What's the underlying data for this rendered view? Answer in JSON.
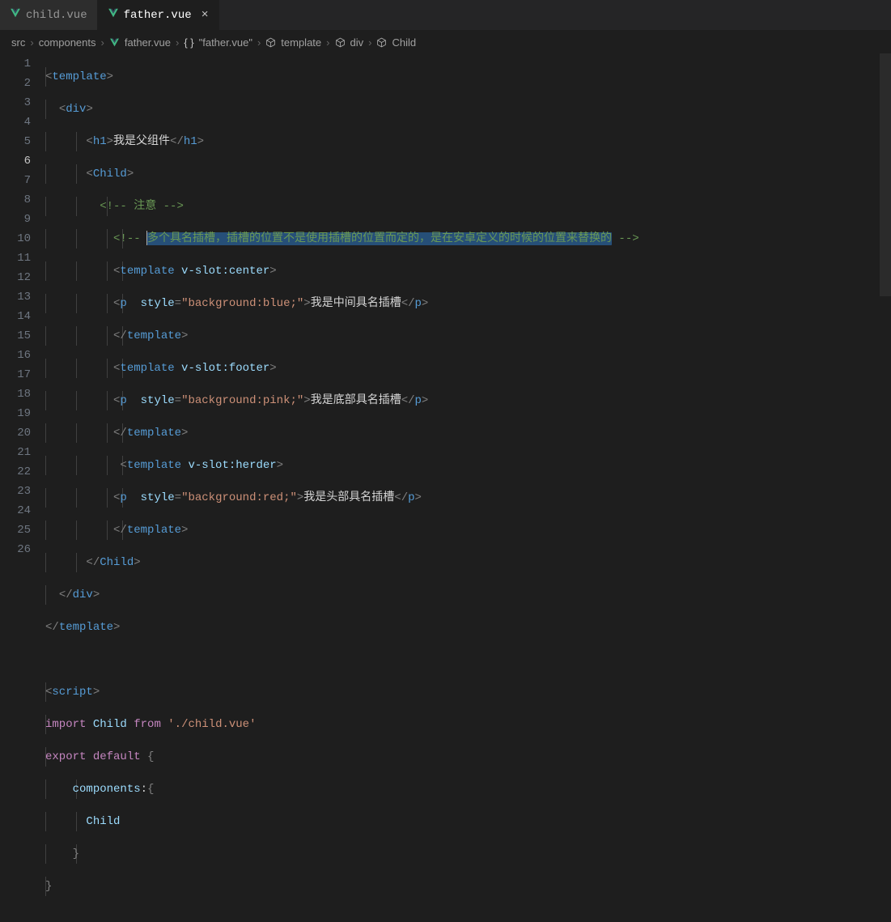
{
  "tabs": [
    {
      "label": "child.vue",
      "active": false
    },
    {
      "label": "father.vue",
      "active": true
    }
  ],
  "breadcrumbs": {
    "parts": [
      "src",
      "components",
      "father.vue",
      "\"father.vue\"",
      "template",
      "div",
      "Child"
    ]
  },
  "code": {
    "h1_text": "我是父组件",
    "comment_note": " 注意 ",
    "selected_comment": "多个具名插槽，插槽的位置不是使用插槽的位置而定的，是在安卓定义的时候的位置来替换的",
    "slot_center": "v-slot:center",
    "slot_footer": "v-slot:footer",
    "slot_herder": "v-slot:herder",
    "style_blue": "\"background:blue;\"",
    "style_pink": "\"background:pink;\"",
    "style_red": "\"background:red;\"",
    "p_center_text": "我是中间具名插槽",
    "p_footer_text": "我是底部具名插槽",
    "p_header_text": "我是头部具名插槽",
    "import_path": "'./child.vue'",
    "kw_import": "import",
    "kw_from": "from",
    "kw_export": "export",
    "kw_default": "default",
    "prop_components": "components",
    "ident_child": "Child",
    "style_attr": "style"
  },
  "line_numbers": [
    "1",
    "2",
    "3",
    "4",
    "5",
    "6",
    "7",
    "8",
    "9",
    "10",
    "11",
    "12",
    "13",
    "14",
    "15",
    "16",
    "17",
    "18",
    "19",
    "20",
    "21",
    "22",
    "23",
    "24",
    "25",
    "26"
  ],
  "current_line": 6
}
